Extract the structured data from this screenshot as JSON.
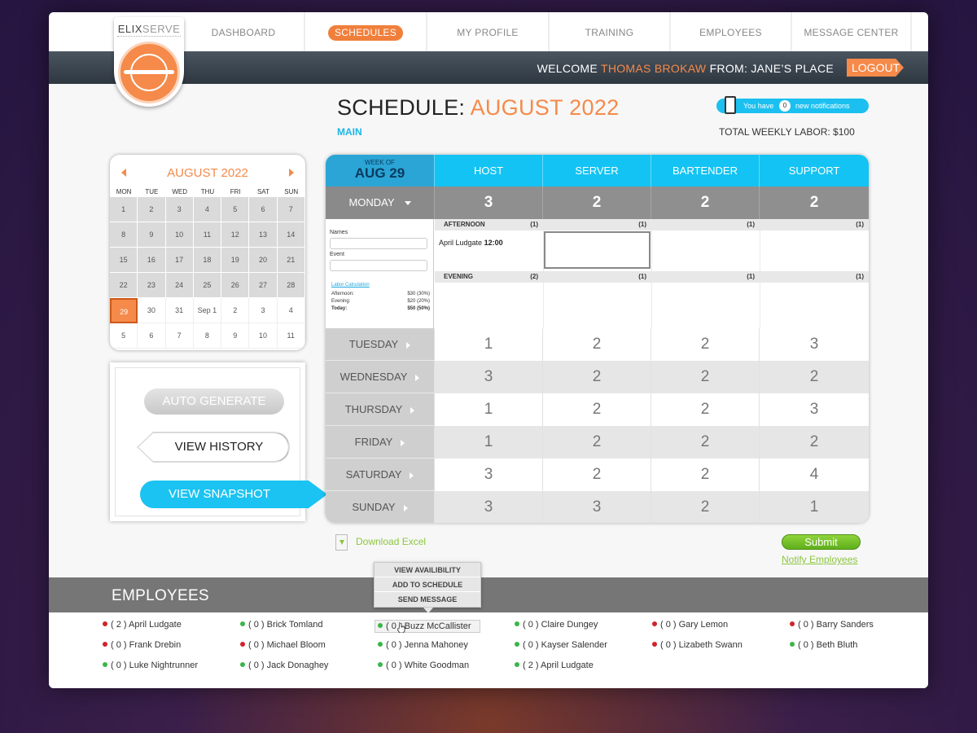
{
  "brand": {
    "part1": "ELIX",
    "part2": "SERVE"
  },
  "nav": [
    {
      "label": "DASHBOARD",
      "active": false
    },
    {
      "label": "SCHEDULES",
      "active": true
    },
    {
      "label": "MY PROFILE",
      "active": false
    },
    {
      "label": "TRAINING",
      "active": false
    },
    {
      "label": "EMPLOYEES",
      "active": false
    },
    {
      "label": "MESSAGE CENTER",
      "active": false
    }
  ],
  "welcome": {
    "prefix": "WELCOME",
    "user": "THOMAS BROKAW",
    "suffix": "FROM: JANE’S PLACE",
    "logout": "LOGOUT"
  },
  "header": {
    "title": "SCHEDULE:",
    "month": "AUGUST 2022",
    "subtitle": "MAIN",
    "labor": "TOTAL WEEKLY LABOR: $100"
  },
  "notifications": {
    "prefix": "You have",
    "count": "0",
    "suffix": "new notifications"
  },
  "calendar": {
    "title": "AUGUST 2022",
    "dows": [
      "MON",
      "TUE",
      "WED",
      "THU",
      "FRI",
      "SAT",
      "SUN"
    ],
    "weeks": [
      [
        "1",
        "2",
        "3",
        "4",
        "5",
        "6",
        "7"
      ],
      [
        "8",
        "9",
        "10",
        "11",
        "12",
        "13",
        "14"
      ],
      [
        "15",
        "16",
        "17",
        "18",
        "19",
        "20",
        "21"
      ],
      [
        "22",
        "23",
        "24",
        "25",
        "26",
        "27",
        "28"
      ],
      [
        "29",
        "30",
        "31",
        "Sep 1",
        "2",
        "3",
        "4"
      ],
      [
        "5",
        "6",
        "7",
        "8",
        "9",
        "10",
        "11"
      ]
    ],
    "selected": "29"
  },
  "actions": {
    "auto": "AUTO GENERATE",
    "history": "VIEW HISTORY",
    "snapshot": "VIEW SNAPSHOT"
  },
  "schedule": {
    "week_of_label": "WEEK OF",
    "week_date": "AUG 29",
    "roles": [
      "HOST",
      "SERVER",
      "BARTENDER",
      "SUPPORT"
    ],
    "monday": {
      "name": "MONDAY",
      "counts": [
        "3",
        "2",
        "2",
        "2"
      ]
    },
    "form": {
      "names_label": "Names",
      "event_label": "Event",
      "labor_link": "Labor Calculation",
      "rows": [
        {
          "label": "Afternoon:",
          "value": "$30 (30%)"
        },
        {
          "label": "Evening:",
          "value": "$20 (20%)"
        },
        {
          "label": "Today:",
          "value": "$50 (50%)"
        }
      ]
    },
    "afternoon": {
      "name": "AFTERNOON",
      "counts": [
        "(1)",
        "(1)",
        "(1)",
        "(1)"
      ],
      "assigned_name": "April Ludgate",
      "assigned_time": "12:00"
    },
    "evening": {
      "name": "EVENING",
      "counts": [
        "(2)",
        "(1)",
        "(1)",
        "(1)"
      ]
    },
    "days": [
      {
        "name": "TUESDAY",
        "counts": [
          "1",
          "2",
          "2",
          "3"
        ]
      },
      {
        "name": "WEDNESDAY",
        "counts": [
          "3",
          "2",
          "2",
          "2"
        ]
      },
      {
        "name": "THURSDAY",
        "counts": [
          "1",
          "2",
          "2",
          "3"
        ]
      },
      {
        "name": "FRIDAY",
        "counts": [
          "1",
          "2",
          "2",
          "2"
        ]
      },
      {
        "name": "SATURDAY",
        "counts": [
          "3",
          "2",
          "2",
          "4"
        ]
      },
      {
        "name": "SUNDAY",
        "counts": [
          "3",
          "3",
          "2",
          "1"
        ]
      }
    ]
  },
  "footer": {
    "download": "Download Excel",
    "submit": "Submit",
    "notify": "Notify Employees"
  },
  "employees": {
    "title": "EMPLOYEES",
    "menu": [
      "VIEW AVAILIBILITY",
      "ADD TO SCHEDULE",
      "SEND MESSAGE"
    ],
    "list": [
      {
        "label": "( 2 ) April Ludgate",
        "status": "red"
      },
      {
        "label": "( 0 ) Brick Tomland",
        "status": "green"
      },
      {
        "label": "( 0 ) Buzz McCallister",
        "status": "green"
      },
      {
        "label": "( 0 ) Claire Dungey",
        "status": "green"
      },
      {
        "label": "( 0 ) Gary Lemon",
        "status": "red"
      },
      {
        "label": "( 0 ) Barry Sanders",
        "status": "red"
      },
      {
        "label": "( 0 ) Frank Drebin",
        "status": "red"
      },
      {
        "label": "( 0 ) Michael Bloom",
        "status": "red"
      },
      {
        "label": "( 0 ) Jenna Mahoney",
        "status": "green"
      },
      {
        "label": "( 0 ) Kayser Salender",
        "status": "green"
      },
      {
        "label": "( 0 ) Lizabeth Swann",
        "status": "red"
      },
      {
        "label": "( 0 ) Beth Bluth",
        "status": "green"
      },
      {
        "label": "( 0 ) Luke Nightrunner",
        "status": "green"
      },
      {
        "label": "( 0 ) Jack Donaghey",
        "status": "green"
      },
      {
        "label": "( 0 ) White Goodman",
        "status": "green"
      },
      {
        "label": "( 2 ) April Ludgate",
        "status": "green"
      }
    ]
  }
}
